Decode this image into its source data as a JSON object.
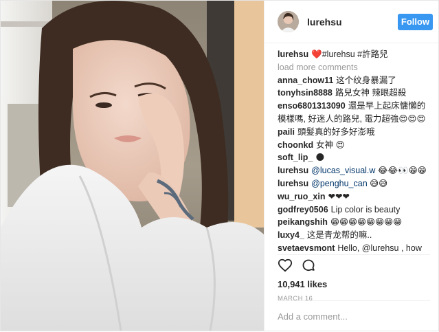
{
  "post": {
    "username": "lurehsu",
    "follow_label": "Follow",
    "caption_user": "lurehsu",
    "caption_text": "❤️#lurehsu #許路兒",
    "load_more": "load more comments",
    "comments": [
      {
        "user": "anna_chow11",
        "text": "这个纹身暴漏了"
      },
      {
        "user": "tonyhsin8888",
        "text": "路兒女神 辣眼超殺"
      },
      {
        "user": "enso6801313090",
        "text": "還是早上起床慵懶的模樣嗎, 好迷人的路兒, 電力超強😍😍😍"
      },
      {
        "user": "paili",
        "text": "頭髮真的好多好澎哦"
      },
      {
        "user": "choonkd",
        "text": "女神 😍"
      },
      {
        "user": "soft_lip_",
        "text": "🌑"
      },
      {
        "user": "lurehsu",
        "mention": "@lucas_visual.w",
        "text": "😂😂👀😁😁"
      },
      {
        "user": "lurehsu",
        "mention": "@penghu_can",
        "text": "😅😅"
      },
      {
        "user": "wu_ruo_xin",
        "text": "❤❤❤"
      },
      {
        "user": "godfrey0506",
        "text": "Lip color is beauty"
      },
      {
        "user": "peikangshih",
        "text": "😁😁😁😁😁😁😁😁"
      },
      {
        "user": "luxy4_",
        "text": "这是青龙帮的嘛.."
      },
      {
        "user": "svetaevsmont",
        "text": "Hello, @lurehsu , how old"
      }
    ],
    "likes": "10,941 likes",
    "date": "MARCH 16",
    "add_comment_placeholder": "Add a comment..."
  },
  "icons": {
    "like": "heart-outline-icon",
    "comment": "comment-bubble-icon"
  },
  "colors": {
    "follow_button": "#3897f0",
    "mention": "#003569",
    "muted": "#999999"
  }
}
